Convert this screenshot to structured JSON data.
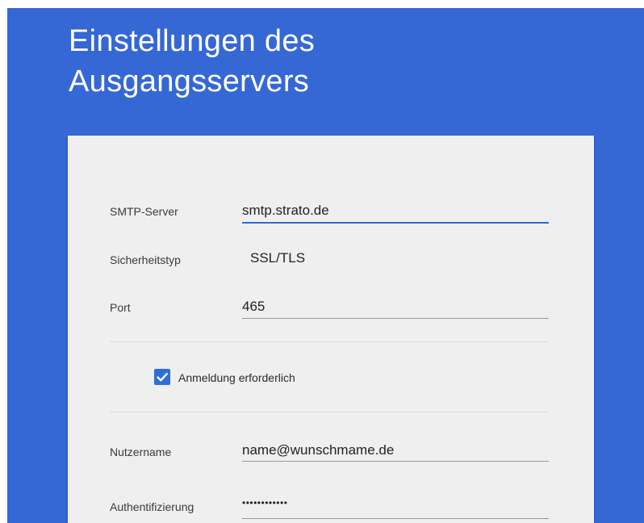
{
  "title": {
    "line1": "Einstellungen des",
    "line2": "Ausgangsservers"
  },
  "form": {
    "smtp_server": {
      "label": "SMTP-Server",
      "value": "smtp.strato.de"
    },
    "security_type": {
      "label": "Sicherheitstyp",
      "value": "SSL/TLS"
    },
    "port": {
      "label": "Port",
      "value": "465"
    },
    "login_required": {
      "label": "Anmeldung erforderlich",
      "checked": true
    },
    "username": {
      "label": "Nutzername",
      "value": "name@wunschmame.de"
    },
    "authentication": {
      "label": "Authentifizierung",
      "value": "••••••••••••"
    }
  },
  "colors": {
    "accent": "#3568d4",
    "checkbox": "#2f6ed8",
    "card": "#efefef"
  },
  "icons": {
    "checkbox": "checkmark-icon"
  }
}
